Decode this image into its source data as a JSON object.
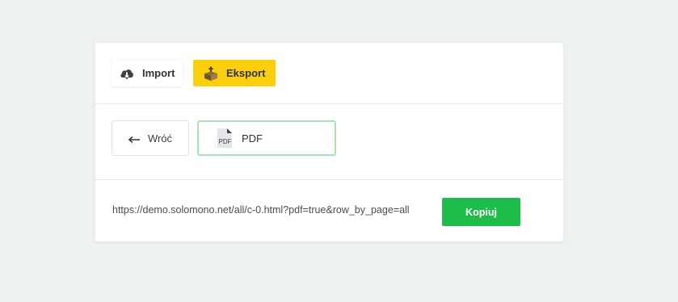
{
  "tabs": {
    "import": {
      "label": "Import",
      "icon": "cloud-download-icon"
    },
    "export": {
      "label": "Eksport",
      "icon": "box-export-icon",
      "active_color": "#f9cf0e"
    }
  },
  "actions": {
    "back_label": "Wróć",
    "back_icon": "arrow-left-icon",
    "pdf_label": "PDF",
    "pdf_icon": "pdf-file-icon",
    "selected_border_color": "#a8e3b8"
  },
  "export_link": {
    "url": "https://demo.solomono.net/all/c-0.html?pdf=true&row_by_page=all",
    "copy_label": "Kopiuj",
    "copy_color": "#1fbe4a"
  }
}
